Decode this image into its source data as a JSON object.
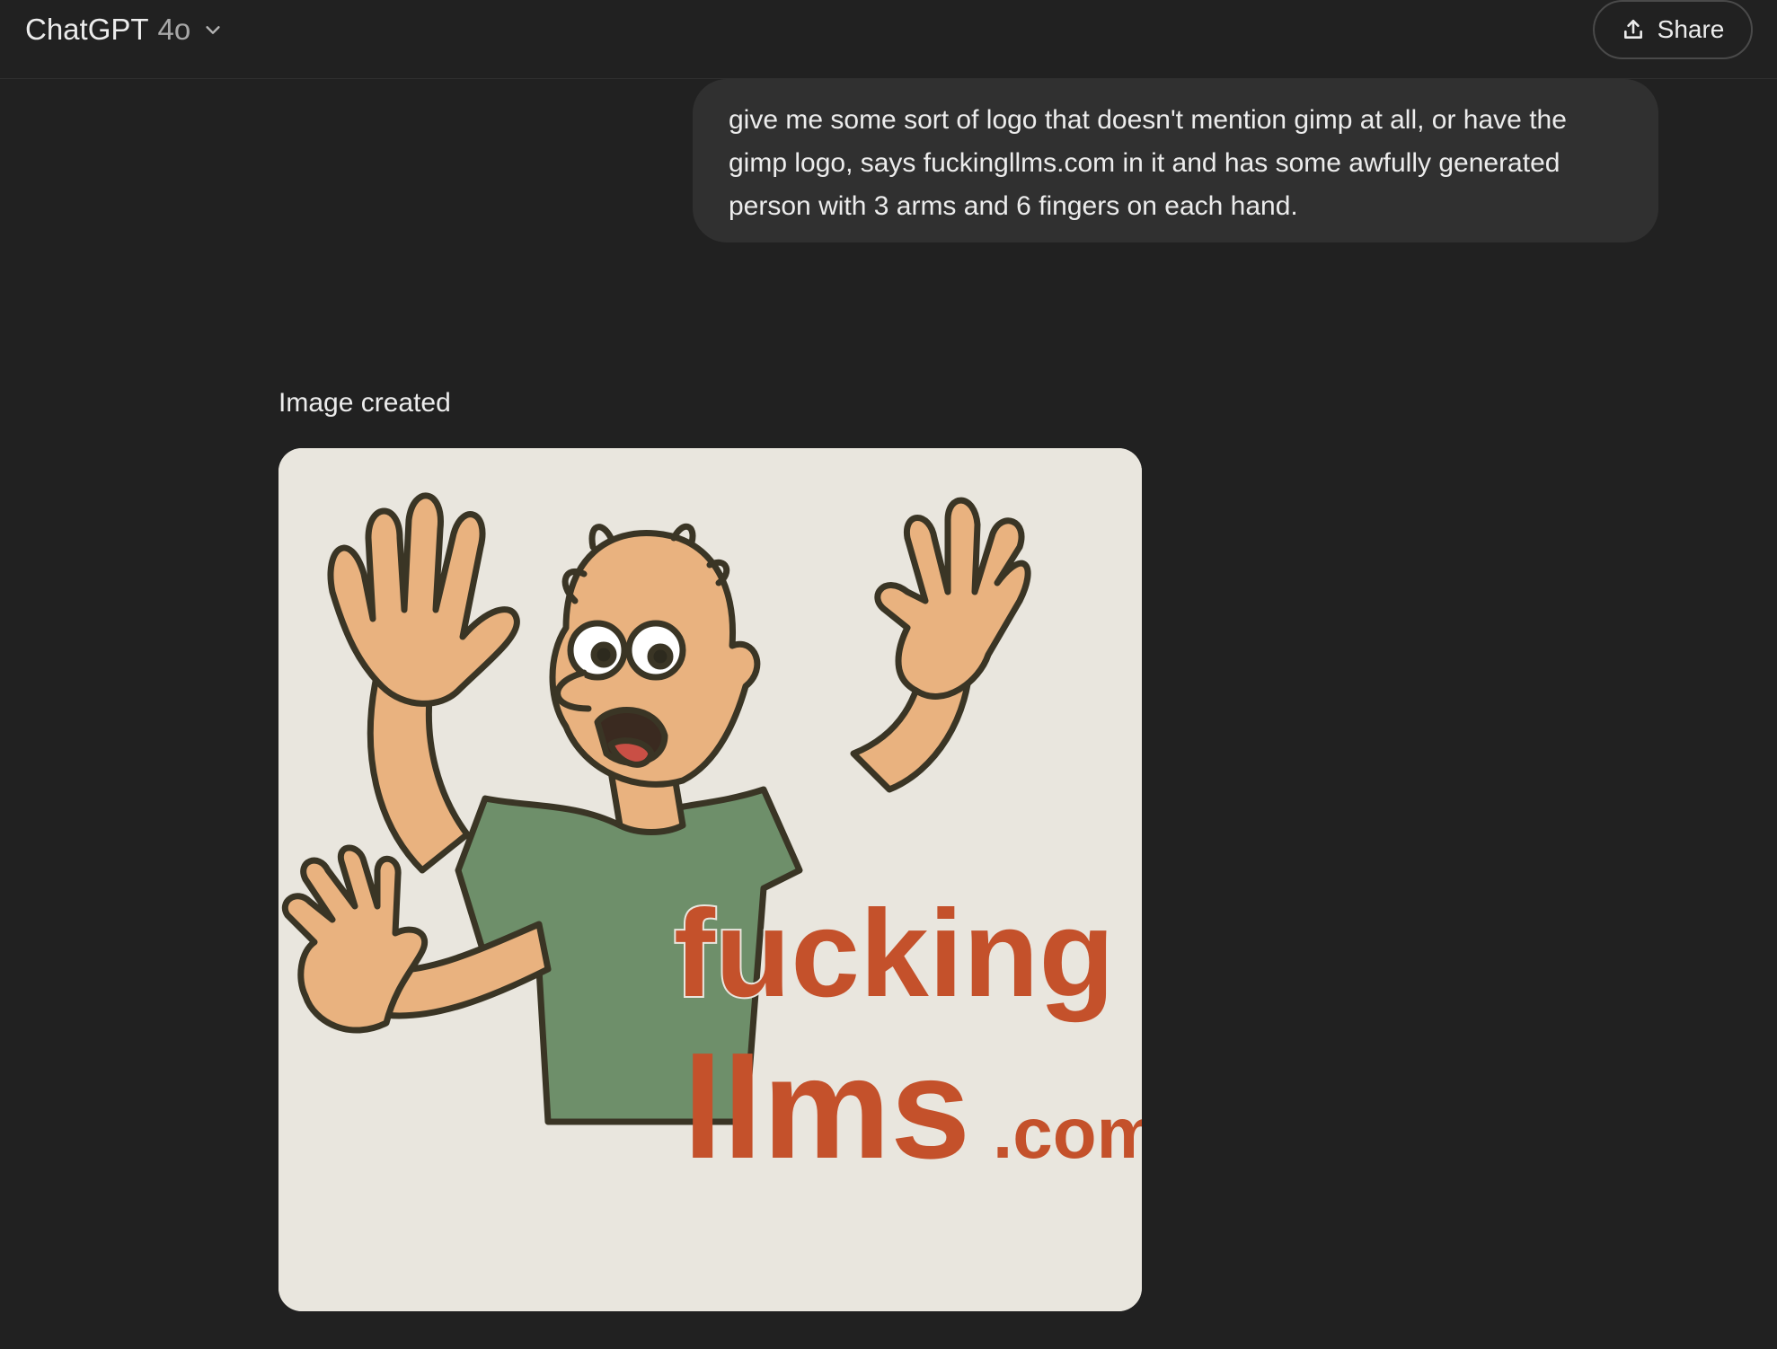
{
  "header": {
    "app_name": "ChatGPT",
    "model_version": "4o",
    "share_label": "Share",
    "icons": [
      "chevron-down-icon",
      "share-upload-icon"
    ]
  },
  "conversation": {
    "user_message": "give me some sort of logo that doesn't mention gimp at all, or have the gimp logo, says fuckingllms.com in it and has some awfully generated person with 3 arms and 6 fingers on each hand.",
    "assistant": {
      "caption": "Image created",
      "image_text": {
        "line1": "fucking",
        "line2": "llms",
        "line2_suffix": ".com"
      }
    }
  },
  "colors": {
    "background": "#212121",
    "bubble": "#303030",
    "logo_text": "#c4512b",
    "shirt": "#6e8f6a",
    "skin": "#e9b27f",
    "image_bg": "#e9e6de"
  }
}
